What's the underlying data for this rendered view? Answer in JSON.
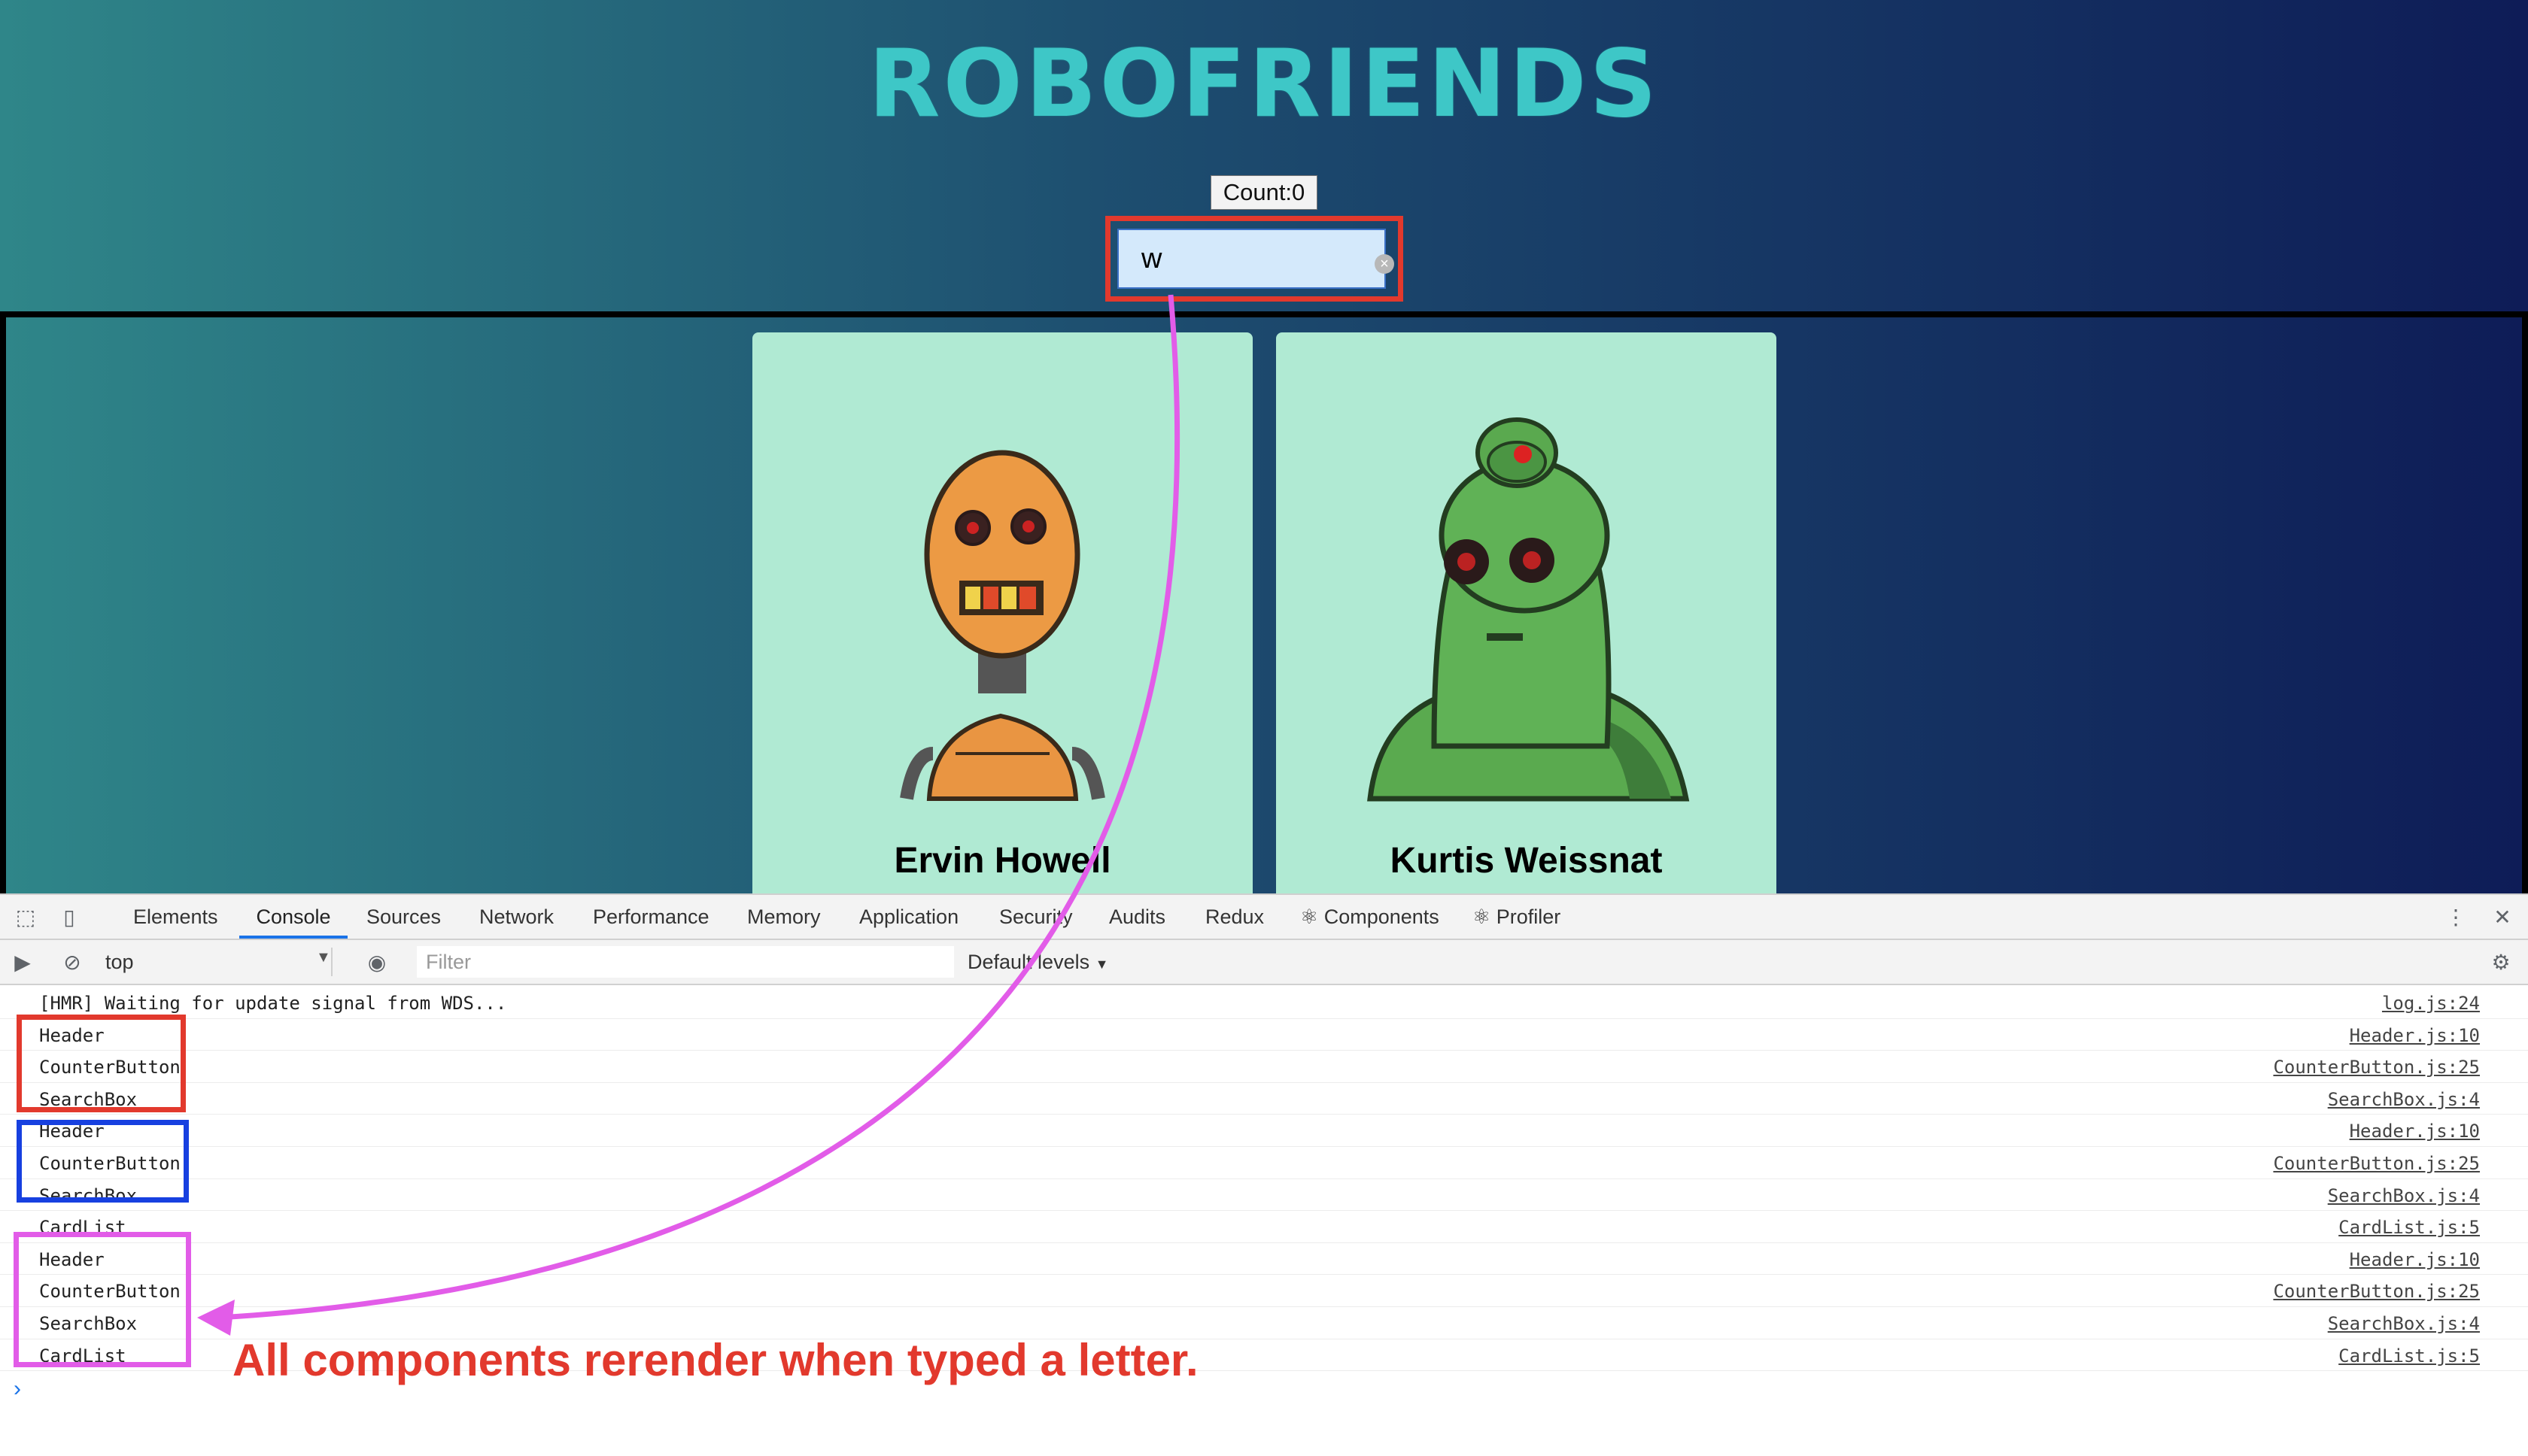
{
  "app": {
    "title": "ROBOFRIENDS",
    "count_label": "Count:0",
    "search_value": "w",
    "cards": [
      {
        "name": "Ervin Howell"
      },
      {
        "name": "Kurtis Weissnat"
      }
    ]
  },
  "devtools": {
    "tabs": [
      "Elements",
      "Console",
      "Sources",
      "Network",
      "Performance",
      "Memory",
      "Application",
      "Security",
      "Audits",
      "Redux",
      "⚛ Components",
      "⚛ Profiler"
    ],
    "active_tab": "Console",
    "context": "top",
    "filter_placeholder": "Filter",
    "levels_label": "Default levels",
    "console_rows": [
      {
        "msg": "[HMR] Waiting for update signal from WDS...",
        "src": "log.js:24"
      },
      {
        "msg": "Header",
        "src": "Header.js:10"
      },
      {
        "msg": "CounterButton",
        "src": "CounterButton.js:25"
      },
      {
        "msg": "SearchBox",
        "src": "SearchBox.js:4"
      },
      {
        "msg": "Header",
        "src": "Header.js:10"
      },
      {
        "msg": "CounterButton",
        "src": "CounterButton.js:25"
      },
      {
        "msg": "SearchBox",
        "src": "SearchBox.js:4"
      },
      {
        "msg": "CardList",
        "src": "CardList.js:5"
      },
      {
        "msg": "Header",
        "src": "Header.js:10"
      },
      {
        "msg": "CounterButton",
        "src": "CounterButton.js:25"
      },
      {
        "msg": "SearchBox",
        "src": "SearchBox.js:4"
      },
      {
        "msg": "CardList",
        "src": "CardList.js:5"
      }
    ],
    "prompt_symbol": "›"
  },
  "annotation": {
    "text": "All components rerender when typed a letter.",
    "colors": {
      "red": "#e2392d",
      "blue": "#1740e0",
      "magenta": "#e25ce8"
    }
  }
}
